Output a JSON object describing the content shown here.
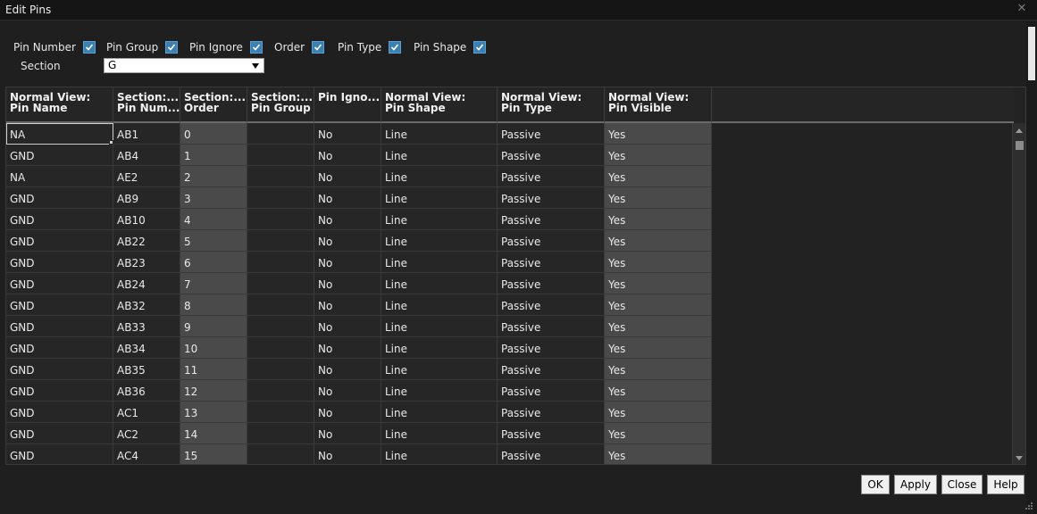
{
  "window": {
    "title": "Edit Pins",
    "close_glyph": "✕"
  },
  "filters": [
    {
      "label": "Pin Number",
      "checked": true
    },
    {
      "label": "Pin Group",
      "checked": true
    },
    {
      "label": "Pin Ignore",
      "checked": true
    },
    {
      "label": "Order",
      "checked": true
    },
    {
      "label": "Pin Type",
      "checked": true
    },
    {
      "label": "Pin Shape",
      "checked": true
    }
  ],
  "section": {
    "label": "Section",
    "value": "G"
  },
  "table": {
    "columns": [
      {
        "line1": "Normal View:",
        "line2": "Pin Name"
      },
      {
        "line1": "Section:...",
        "line2": "Pin Num..."
      },
      {
        "line1": "Section:...",
        "line2": "Order"
      },
      {
        "line1": "Section:...",
        "line2": "Pin Group"
      },
      {
        "line1": "",
        "line2": "Pin Igno..."
      },
      {
        "line1": "Normal View:",
        "line2": "Pin Shape"
      },
      {
        "line1": "Normal View:",
        "line2": "Pin Type"
      },
      {
        "line1": "Normal View:",
        "line2": "Pin Visible"
      }
    ],
    "rows": [
      [
        "NA",
        "AB1",
        "0",
        "",
        "No",
        "Line",
        "Passive",
        "Yes"
      ],
      [
        "GND",
        "AB4",
        "1",
        "",
        "No",
        "Line",
        "Passive",
        "Yes"
      ],
      [
        "NA",
        "AE2",
        "2",
        "",
        "No",
        "Line",
        "Passive",
        "Yes"
      ],
      [
        "GND",
        "AB9",
        "3",
        "",
        "No",
        "Line",
        "Passive",
        "Yes"
      ],
      [
        "GND",
        "AB10",
        "4",
        "",
        "No",
        "Line",
        "Passive",
        "Yes"
      ],
      [
        "GND",
        "AB22",
        "5",
        "",
        "No",
        "Line",
        "Passive",
        "Yes"
      ],
      [
        "GND",
        "AB23",
        "6",
        "",
        "No",
        "Line",
        "Passive",
        "Yes"
      ],
      [
        "GND",
        "AB24",
        "7",
        "",
        "No",
        "Line",
        "Passive",
        "Yes"
      ],
      [
        "GND",
        "AB32",
        "8",
        "",
        "No",
        "Line",
        "Passive",
        "Yes"
      ],
      [
        "GND",
        "AB33",
        "9",
        "",
        "No",
        "Line",
        "Passive",
        "Yes"
      ],
      [
        "GND",
        "AB34",
        "10",
        "",
        "No",
        "Line",
        "Passive",
        "Yes"
      ],
      [
        "GND",
        "AB35",
        "11",
        "",
        "No",
        "Line",
        "Passive",
        "Yes"
      ],
      [
        "GND",
        "AB36",
        "12",
        "",
        "No",
        "Line",
        "Passive",
        "Yes"
      ],
      [
        "GND",
        "AC1",
        "13",
        "",
        "No",
        "Line",
        "Passive",
        "Yes"
      ],
      [
        "GND",
        "AC2",
        "14",
        "",
        "No",
        "Line",
        "Passive",
        "Yes"
      ],
      [
        "GND",
        "AC4",
        "15",
        "",
        "No",
        "Line",
        "Passive",
        "Yes"
      ]
    ]
  },
  "buttons": {
    "ok": "OK",
    "apply": "Apply",
    "close": "Close",
    "help": "Help"
  },
  "colors": {
    "accent_check": "#3c7fb1",
    "alt_column": "#4a4a4a",
    "background": "#1f1f1f"
  }
}
